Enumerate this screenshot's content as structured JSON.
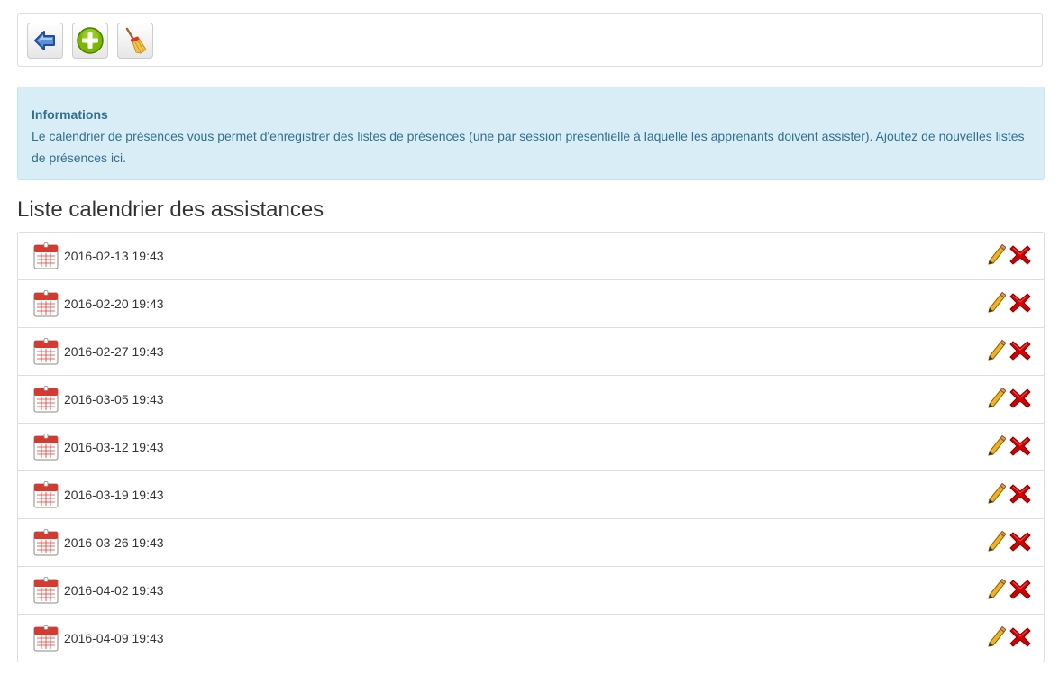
{
  "toolbar": {
    "buttons": [
      {
        "icon": "back-arrow-icon",
        "color": "#2b5fb4"
      },
      {
        "icon": "add-plus-icon",
        "color": "#7ab800"
      },
      {
        "icon": "broom-icon",
        "color": "#e8a317"
      }
    ]
  },
  "info": {
    "title": "Informations",
    "text": "Le calendrier de présences vous permet d'enregistrer des listes de présences (une par session présentielle à laquelle les apprenants doivent assister). Ajoutez de nouvelles listes de présences ici."
  },
  "heading": "Liste calendrier des assistances",
  "calendar": {
    "items": [
      {
        "date": "2016-02-13 19:43"
      },
      {
        "date": "2016-02-20 19:43"
      },
      {
        "date": "2016-02-27 19:43"
      },
      {
        "date": "2016-03-05 19:43"
      },
      {
        "date": "2016-03-12 19:43"
      },
      {
        "date": "2016-03-19 19:43"
      },
      {
        "date": "2016-03-26 19:43"
      },
      {
        "date": "2016-04-02 19:43"
      },
      {
        "date": "2016-04-09 19:43"
      }
    ],
    "row_icons": {
      "calendar": "calendar-icon",
      "edit": "pencil-icon",
      "delete": "red-x-icon"
    }
  },
  "colors": {
    "info_bg": "#d9edf7",
    "info_text": "#31708f",
    "delete_red": "#d40000",
    "calendar_red": "#d63a2e",
    "pencil_yellow": "#f2b21c"
  }
}
